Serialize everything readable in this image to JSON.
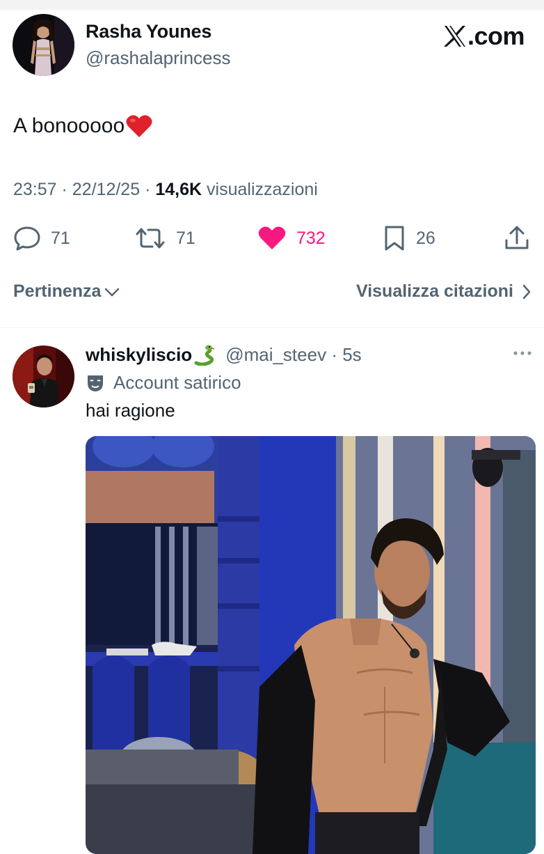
{
  "tweet": {
    "author_name": "Rasha Younes",
    "author_handle": "@rashalaprincess",
    "logo_text": ".com",
    "text": "A bonooooo",
    "text_emoji": "red-heart",
    "time": "23:57",
    "date": "22/12/25",
    "views_count": "14,6K",
    "views_label": "visualizzazioni",
    "actions": {
      "replies": "71",
      "reposts": "71",
      "likes": "732",
      "bookmarks": "26"
    },
    "liked": true,
    "accent_like_color": "#f91880"
  },
  "sort": {
    "relevance_label": "Pertinenza",
    "quotes_label": "Visualizza citazioni"
  },
  "reply": {
    "name": "whiskyliscio",
    "name_emoji": "snake",
    "handle": "@mai_steev",
    "time": "5s",
    "badge_label": "Account satirico",
    "badge_icon": "theater-mask-icon",
    "text": "hai ragione",
    "media_description_icon": "video-still"
  },
  "colors": {
    "text_primary": "#0f1419",
    "text_secondary": "#536471",
    "divider": "#eff3f4"
  }
}
